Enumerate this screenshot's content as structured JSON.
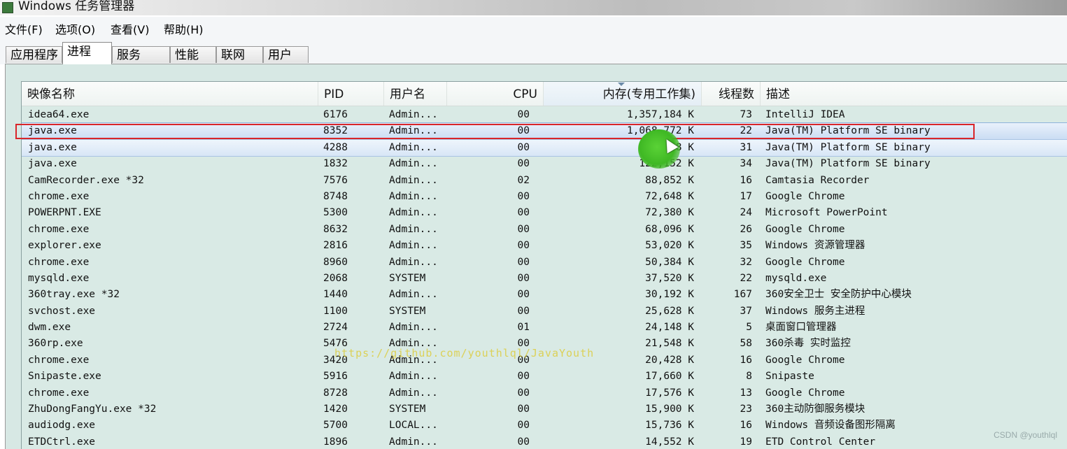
{
  "window": {
    "title": "Windows 任务管理器"
  },
  "menu": [
    "文件(F)",
    "选项(O)",
    "查看(V)",
    "帮助(H)"
  ],
  "tabs": [
    "应用程序",
    "进程",
    "服务",
    "性能",
    "联网",
    "用户"
  ],
  "active_tab": "进程",
  "columns": {
    "name": "映像名称",
    "pid": "PID",
    "user": "用户名",
    "cpu": "CPU",
    "memory": "内存(专用工作集)",
    "threads": "线程数",
    "description": "描述"
  },
  "sorted_column": "memory",
  "processes": [
    {
      "name": "idea64.exe",
      "pid": "6176",
      "user": "Admin...",
      "cpu": "00",
      "memory": "1,357,184 K",
      "threads": "73",
      "description": "IntelliJ IDEA"
    },
    {
      "name": "java.exe",
      "pid": "8352",
      "user": "Admin...",
      "cpu": "00",
      "memory": "1,068,772 K",
      "threads": "22",
      "description": "Java(TM) Platform SE binary"
    },
    {
      "name": "java.exe",
      "pid": "4288",
      "user": "Admin...",
      "cpu": "00",
      "memory": "201,??8 K",
      "threads": "31",
      "description": "Java(TM) Platform SE binary"
    },
    {
      "name": "java.exe",
      "pid": "1832",
      "user": "Admin...",
      "cpu": "00",
      "memory": "122,152 K",
      "threads": "34",
      "description": "Java(TM) Platform SE binary"
    },
    {
      "name": "CamRecorder.exe *32",
      "pid": "7576",
      "user": "Admin...",
      "cpu": "02",
      "memory": "88,852 K",
      "threads": "16",
      "description": "Camtasia Recorder"
    },
    {
      "name": "chrome.exe",
      "pid": "8748",
      "user": "Admin...",
      "cpu": "00",
      "memory": "72,648 K",
      "threads": "17",
      "description": "Google Chrome"
    },
    {
      "name": "POWERPNT.EXE",
      "pid": "5300",
      "user": "Admin...",
      "cpu": "00",
      "memory": "72,380 K",
      "threads": "24",
      "description": "Microsoft PowerPoint"
    },
    {
      "name": "chrome.exe",
      "pid": "8632",
      "user": "Admin...",
      "cpu": "00",
      "memory": "68,096 K",
      "threads": "26",
      "description": "Google Chrome"
    },
    {
      "name": "explorer.exe",
      "pid": "2816",
      "user": "Admin...",
      "cpu": "00",
      "memory": "53,020 K",
      "threads": "35",
      "description": "Windows 资源管理器"
    },
    {
      "name": "chrome.exe",
      "pid": "8960",
      "user": "Admin...",
      "cpu": "00",
      "memory": "50,384 K",
      "threads": "32",
      "description": "Google Chrome"
    },
    {
      "name": "mysqld.exe",
      "pid": "2068",
      "user": "SYSTEM",
      "cpu": "00",
      "memory": "37,520 K",
      "threads": "22",
      "description": "mysqld.exe"
    },
    {
      "name": "360tray.exe *32",
      "pid": "1440",
      "user": "Admin...",
      "cpu": "00",
      "memory": "30,192 K",
      "threads": "167",
      "description": "360安全卫士 安全防护中心模块"
    },
    {
      "name": "svchost.exe",
      "pid": "1100",
      "user": "SYSTEM",
      "cpu": "00",
      "memory": "25,628 K",
      "threads": "37",
      "description": "Windows 服务主进程"
    },
    {
      "name": "dwm.exe",
      "pid": "2724",
      "user": "Admin...",
      "cpu": "01",
      "memory": "24,148 K",
      "threads": "5",
      "description": "桌面窗口管理器"
    },
    {
      "name": "360rp.exe",
      "pid": "5476",
      "user": "Admin...",
      "cpu": "00",
      "memory": "21,548 K",
      "threads": "58",
      "description": "360杀毒 实时监控"
    },
    {
      "name": "chrome.exe",
      "pid": "3420",
      "user": "Admin...",
      "cpu": "00",
      "memory": "20,428 K",
      "threads": "16",
      "description": "Google Chrome"
    },
    {
      "name": "Snipaste.exe",
      "pid": "5916",
      "user": "Admin...",
      "cpu": "00",
      "memory": "17,660 K",
      "threads": "8",
      "description": "Snipaste"
    },
    {
      "name": "chrome.exe",
      "pid": "8728",
      "user": "Admin...",
      "cpu": "00",
      "memory": "17,576 K",
      "threads": "13",
      "description": "Google Chrome"
    },
    {
      "name": "ZhuDongFangYu.exe *32",
      "pid": "1420",
      "user": "SYSTEM",
      "cpu": "00",
      "memory": "15,900 K",
      "threads": "23",
      "description": "360主动防御服务模块"
    },
    {
      "name": "audiodg.exe",
      "pid": "5700",
      "user": "LOCAL...",
      "cpu": "00",
      "memory": "15,736 K",
      "threads": "16",
      "description": "Windows 音频设备图形隔离"
    },
    {
      "name": "ETDCtrl.exe",
      "pid": "1896",
      "user": "Admin...",
      "cpu": "00",
      "memory": "14,552 K",
      "threads": "19",
      "description": "ETD Control Center"
    }
  ],
  "selected_row": 1,
  "hover_row": 2,
  "overlay": {
    "watermark_url": "https://github.com/youthlql/JavaYouth",
    "credit": "CSDN @youthlql"
  },
  "colors": {
    "highlight_box": "#d9252a",
    "selection": "#c9dcf3",
    "list_background": "#d9eae5",
    "cursor_marker": "#3fb824"
  }
}
